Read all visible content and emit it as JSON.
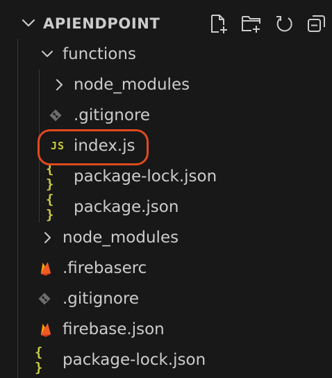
{
  "explorer": {
    "title": "APIENDPOINT",
    "actions": [
      {
        "icon": "new-file-icon"
      },
      {
        "icon": "new-folder-icon"
      },
      {
        "icon": "refresh-icon"
      },
      {
        "icon": "collapse-all-icon"
      }
    ],
    "tree": [
      {
        "label": "functions",
        "type": "folder",
        "expanded": true,
        "depth": 0
      },
      {
        "label": "node_modules",
        "type": "folder",
        "expanded": false,
        "depth": 1
      },
      {
        "label": ".gitignore",
        "type": "git",
        "depth": 1
      },
      {
        "label": "index.js",
        "type": "js",
        "icon_text": "JS",
        "depth": 1,
        "highlighted": true
      },
      {
        "label": "package-lock.json",
        "type": "json",
        "icon_text": "{ }",
        "depth": 1
      },
      {
        "label": "package.json",
        "type": "json",
        "icon_text": "{ }",
        "depth": 1
      },
      {
        "label": "node_modules",
        "type": "folder",
        "expanded": false,
        "depth": 0
      },
      {
        "label": ".firebaserc",
        "type": "firebase",
        "depth": 0
      },
      {
        "label": ".gitignore",
        "type": "git",
        "depth": 0
      },
      {
        "label": "firebase.json",
        "type": "firebase",
        "depth": 0
      },
      {
        "label": "package-lock.json",
        "type": "json",
        "icon_text": "{ }",
        "depth": 0
      }
    ],
    "colors": {
      "background": "#181818",
      "text": "#cccccc",
      "json_icon": "#cbcb41",
      "js_icon": "#cbcb41",
      "firebase_icon": "#f5820d",
      "git_icon": "#7a7a7a",
      "highlight": "#e04a1f"
    }
  }
}
